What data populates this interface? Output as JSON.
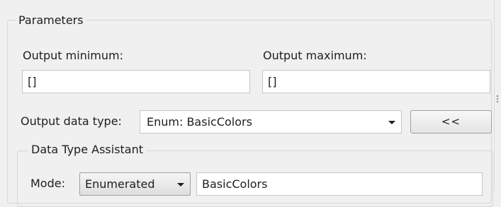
{
  "parameters": {
    "title": "Parameters",
    "output_minimum": {
      "label": "Output minimum:",
      "value": "[]"
    },
    "output_maximum": {
      "label": "Output maximum:",
      "value": "[]"
    },
    "output_data_type": {
      "label": "Output data type:",
      "selected": "Enum: BasicColors",
      "assistant_toggle_label": "<<"
    }
  },
  "data_type_assistant": {
    "title": "Data Type Assistant",
    "mode_label": "Mode:",
    "mode_selected": "Enumerated",
    "class_value": "BasicColors"
  },
  "icons": {
    "dropdown": "chevron-down-icon",
    "resize_grip": "grip-icon"
  },
  "colors": {
    "background": "#f0f0f0",
    "field_border": "#c6c6c6",
    "group_border": "#d6d6d6",
    "text": "#1e1e1e"
  }
}
